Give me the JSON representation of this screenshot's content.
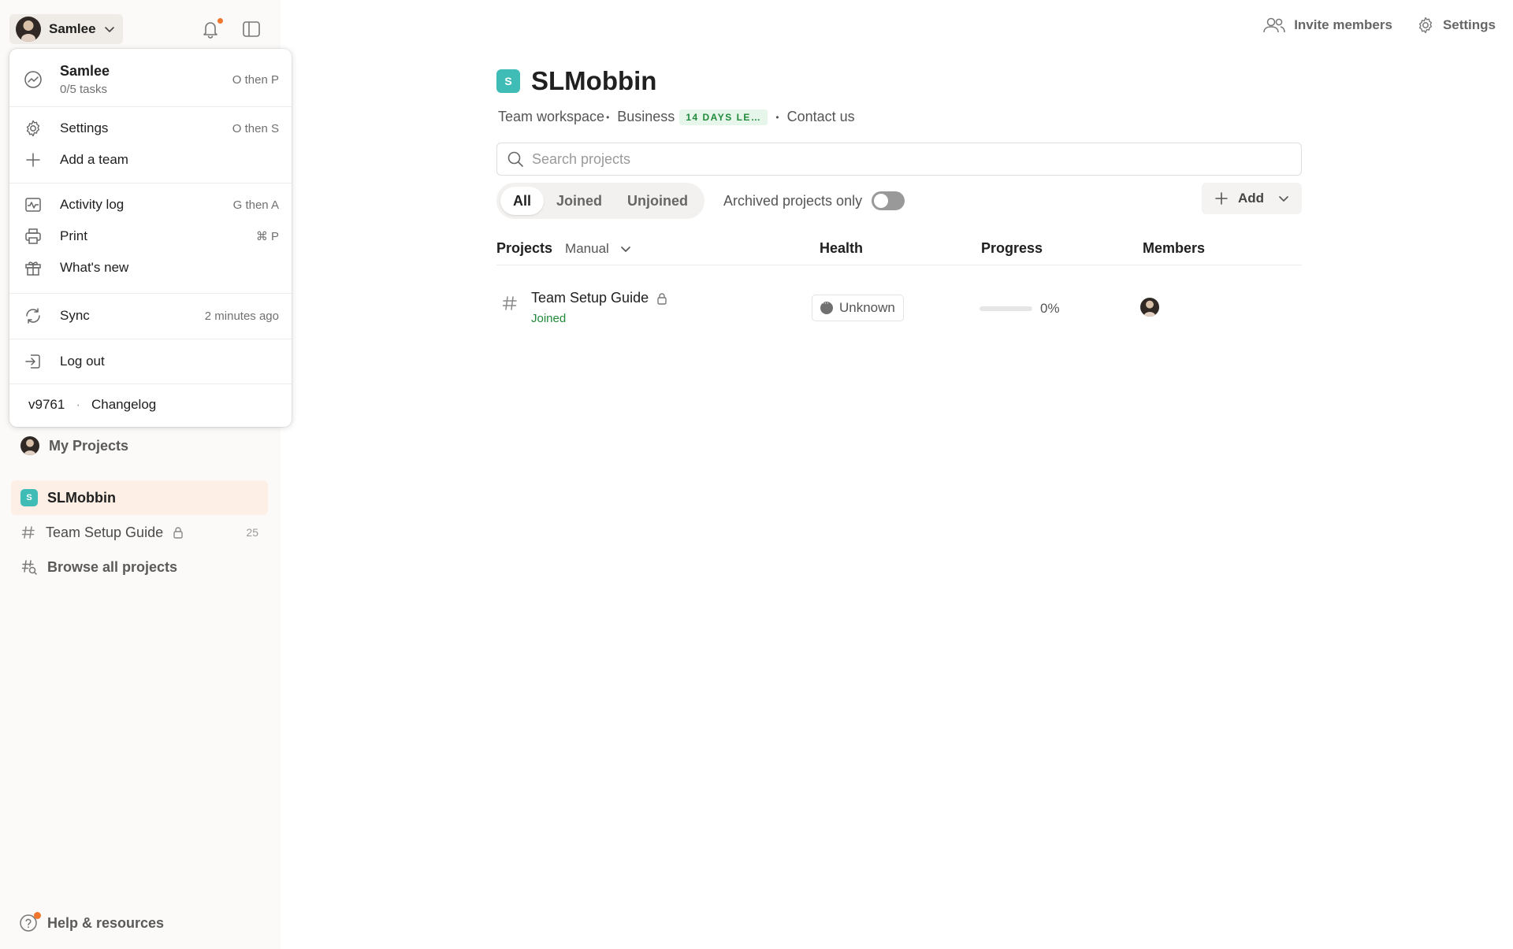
{
  "user": {
    "name": "Samlee"
  },
  "menu": {
    "profile": {
      "name": "Samlee",
      "tasks": "0/5 tasks",
      "shortcut": "O then P"
    },
    "items": [
      {
        "label": "Settings",
        "shortcut": "O then S"
      },
      {
        "label": "Add a team",
        "shortcut": ""
      },
      {
        "label": "Activity log",
        "shortcut": "G then A"
      },
      {
        "label": "Print",
        "shortcut": "⌘ P"
      },
      {
        "label": "What's new",
        "shortcut": ""
      },
      {
        "label": "Sync",
        "shortcut": "2 minutes ago"
      },
      {
        "label": "Log out",
        "shortcut": ""
      }
    ],
    "footer": {
      "version": "v9761",
      "dot": "·",
      "changelog": "Changelog"
    }
  },
  "sidebar": {
    "my_projects": "My Projects",
    "workspace": "SLMobbin",
    "workspace_initial": "S",
    "project": {
      "name": "Team Setup Guide",
      "count": "25"
    },
    "browse": "Browse all projects",
    "help": "Help & resources"
  },
  "header": {
    "invite": "Invite members",
    "settings": "Settings"
  },
  "main": {
    "title": "SLMobbin",
    "title_initial": "S",
    "meta": {
      "workspace": "Team workspace",
      "sep1": "•",
      "plan": "Business",
      "trial": "14 DAYS LE…",
      "sep2": "•",
      "contact": "Contact us"
    },
    "search_placeholder": "Search projects",
    "tabs": [
      "All",
      "Joined",
      "Unjoined"
    ],
    "archived_label": "Archived projects only",
    "add_label": "Add",
    "table": {
      "headers": {
        "projects": "Projects",
        "sort": "Manual",
        "health": "Health",
        "progress": "Progress",
        "members": "Members"
      },
      "rows": [
        {
          "name": "Team Setup Guide",
          "status": "Joined",
          "health": "Unknown",
          "progress": 0,
          "progress_text": "0%"
        }
      ]
    }
  },
  "colors": {
    "accent": "#3ebcb5",
    "notification": "#f0762e",
    "joined": "#1e8a3a",
    "active_bg": "#fdefe5"
  }
}
